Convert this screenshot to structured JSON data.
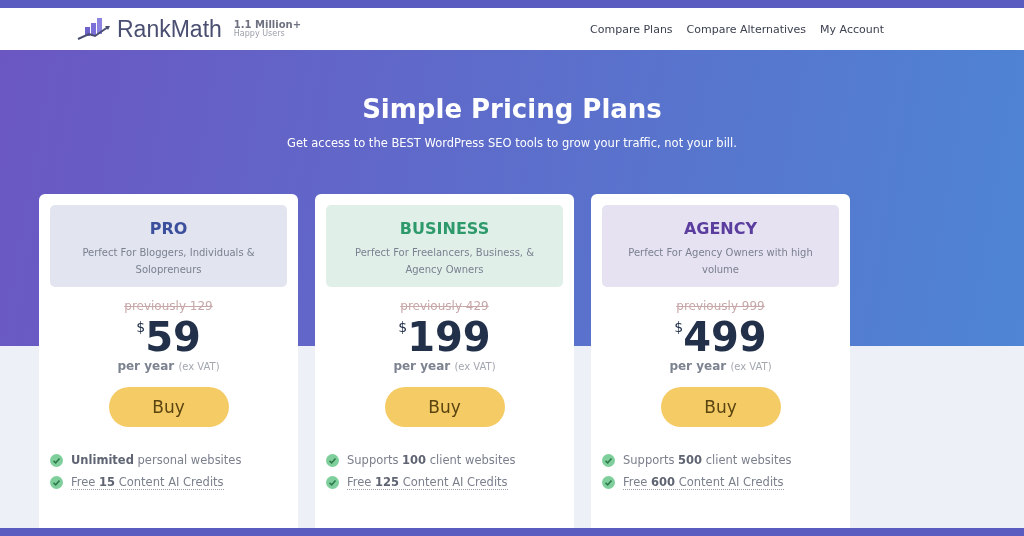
{
  "header": {
    "logo_text": "RankMath",
    "users_count": "1.1 Million+",
    "users_label": "Happy Users",
    "nav": [
      "Compare Plans",
      "Compare Alternatives",
      "My Account"
    ]
  },
  "hero": {
    "title": "Simple Pricing Plans",
    "subtitle": "Get access to the BEST WordPress SEO tools to grow your traffic, not your bill."
  },
  "plans": [
    {
      "name": "PRO",
      "color": "#3b4f9c",
      "description": "Perfect For Bloggers, Individuals & Solopreneurs",
      "previous": "previously 129",
      "currency": "$",
      "price": "59",
      "period": "per year",
      "tax_note": "(ex VAT)",
      "button": "Buy",
      "features": [
        {
          "text": "**Unlimited** personal websites",
          "underlined": false
        },
        {
          "text": "Free **15** Content AI Credits",
          "underlined": true
        }
      ]
    },
    {
      "name": "BUSINESS",
      "color": "#2e9a6b",
      "description": "Perfect For Freelancers, Business, & Agency Owners",
      "previous": "previously 429",
      "currency": "$",
      "price": "199",
      "period": "per year",
      "tax_note": "(ex VAT)",
      "button": "Buy",
      "features": [
        {
          "text": "Supports **100** client websites",
          "underlined": false
        },
        {
          "text": "Free **125** Content AI Credits",
          "underlined": true
        }
      ]
    },
    {
      "name": "AGENCY",
      "color": "#5a3d9e",
      "description": "Perfect For Agency Owners with high volume",
      "previous": "previously 999",
      "currency": "$",
      "price": "499",
      "period": "per year",
      "tax_note": "(ex VAT)",
      "button": "Buy",
      "features": [
        {
          "text": "Supports **500** client websites",
          "underlined": false
        },
        {
          "text": "Free **600** Content AI Credits",
          "underlined": true
        }
      ]
    }
  ]
}
